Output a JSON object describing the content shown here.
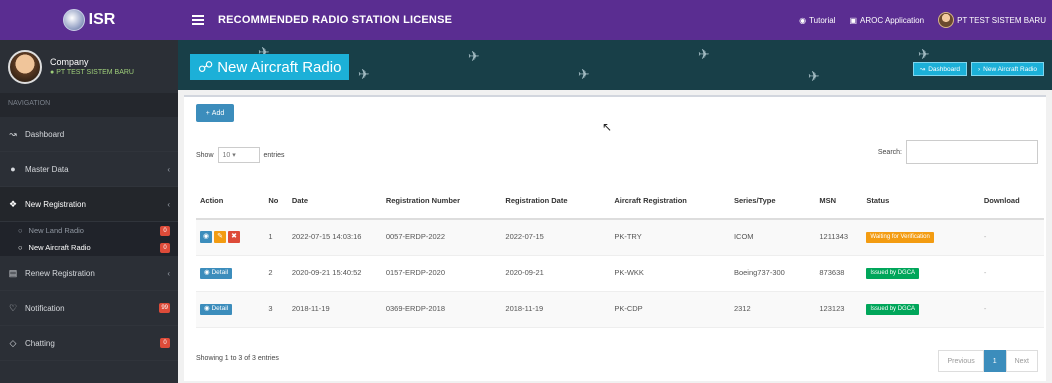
{
  "app": {
    "brand": "ISR",
    "page_heading": "RECOMMENDED RADIO STATION LICENSE",
    "top_links": {
      "tutorial": "Tutorial",
      "application": "AROC Application",
      "user": "PT TEST SISTEM BARU"
    }
  },
  "sidebar": {
    "profile_name": "Company",
    "profile_sub": "PT TEST SISTEM BARU",
    "nav_header": "NAVIGATION",
    "items": [
      {
        "label": "Dashboard",
        "icon": "chart-icon"
      },
      {
        "label": "Master Data",
        "icon": "circle-icon"
      },
      {
        "label": "New Registration",
        "icon": "signal-icon"
      },
      {
        "label": "Renew Registration",
        "icon": "doc-icon"
      },
      {
        "label": "Notification",
        "icon": "bell-icon",
        "badge": "99"
      },
      {
        "label": "Chatting",
        "icon": "chat-icon",
        "badge": "0"
      }
    ],
    "sub_items": [
      {
        "label": "New Land Radio",
        "badge": "0"
      },
      {
        "label": "New Aircraft Radio",
        "badge": "0"
      }
    ]
  },
  "page": {
    "title": "New Aircraft Radio",
    "crumbs": [
      "Dashboard",
      "New Aircraft Radio"
    ]
  },
  "table_controls": {
    "add_label": "Add",
    "show_label": "Show",
    "show_value": "10",
    "entries_label": "entries",
    "search_label": "Search:",
    "info": "Showing 1 to 3 of 3 entries",
    "prev": "Previous",
    "page": "1",
    "next": "Next"
  },
  "table": {
    "headers": [
      "Action",
      "No",
      "Date",
      "Registration Number",
      "Registration Date",
      "Aircraft Registration",
      "Series/Type",
      "MSN",
      "Status",
      "Download"
    ],
    "rows": [
      {
        "no": "1",
        "date": "2022-07-15 14:03:16",
        "reg_no": "0057-ERDP-2022",
        "reg_date": "2022-07-15",
        "aircraft": "PK-TRY",
        "series": "ICOM",
        "msn": "1211343",
        "status": "Waiting for Verification",
        "status_color": "#f39c12",
        "download": "-"
      },
      {
        "no": "2",
        "date": "2020-09-21 15:40:52",
        "reg_no": "0157-ERDP-2020",
        "reg_date": "2020-09-21",
        "aircraft": "PK-WKK",
        "series": "Boeing737-300",
        "msn": "873638",
        "status": "Issued by DGCA",
        "status_color": "#00a65a",
        "download": "-"
      },
      {
        "no": "3",
        "date": "2018-11-19",
        "reg_no": "0369-ERDP-2018",
        "reg_date": "2018-11-19",
        "aircraft": "PK-CDP",
        "series": "2312",
        "msn": "123123",
        "status": "Issued by DGCA",
        "status_color": "#00a65a",
        "download": "-"
      }
    ],
    "detail_label": "Detail"
  },
  "colors": {
    "topbar": "#5a2d91",
    "sidebar": "#2b2f36",
    "accent": "#1cb0d8",
    "primary": "#3c8dbc"
  }
}
